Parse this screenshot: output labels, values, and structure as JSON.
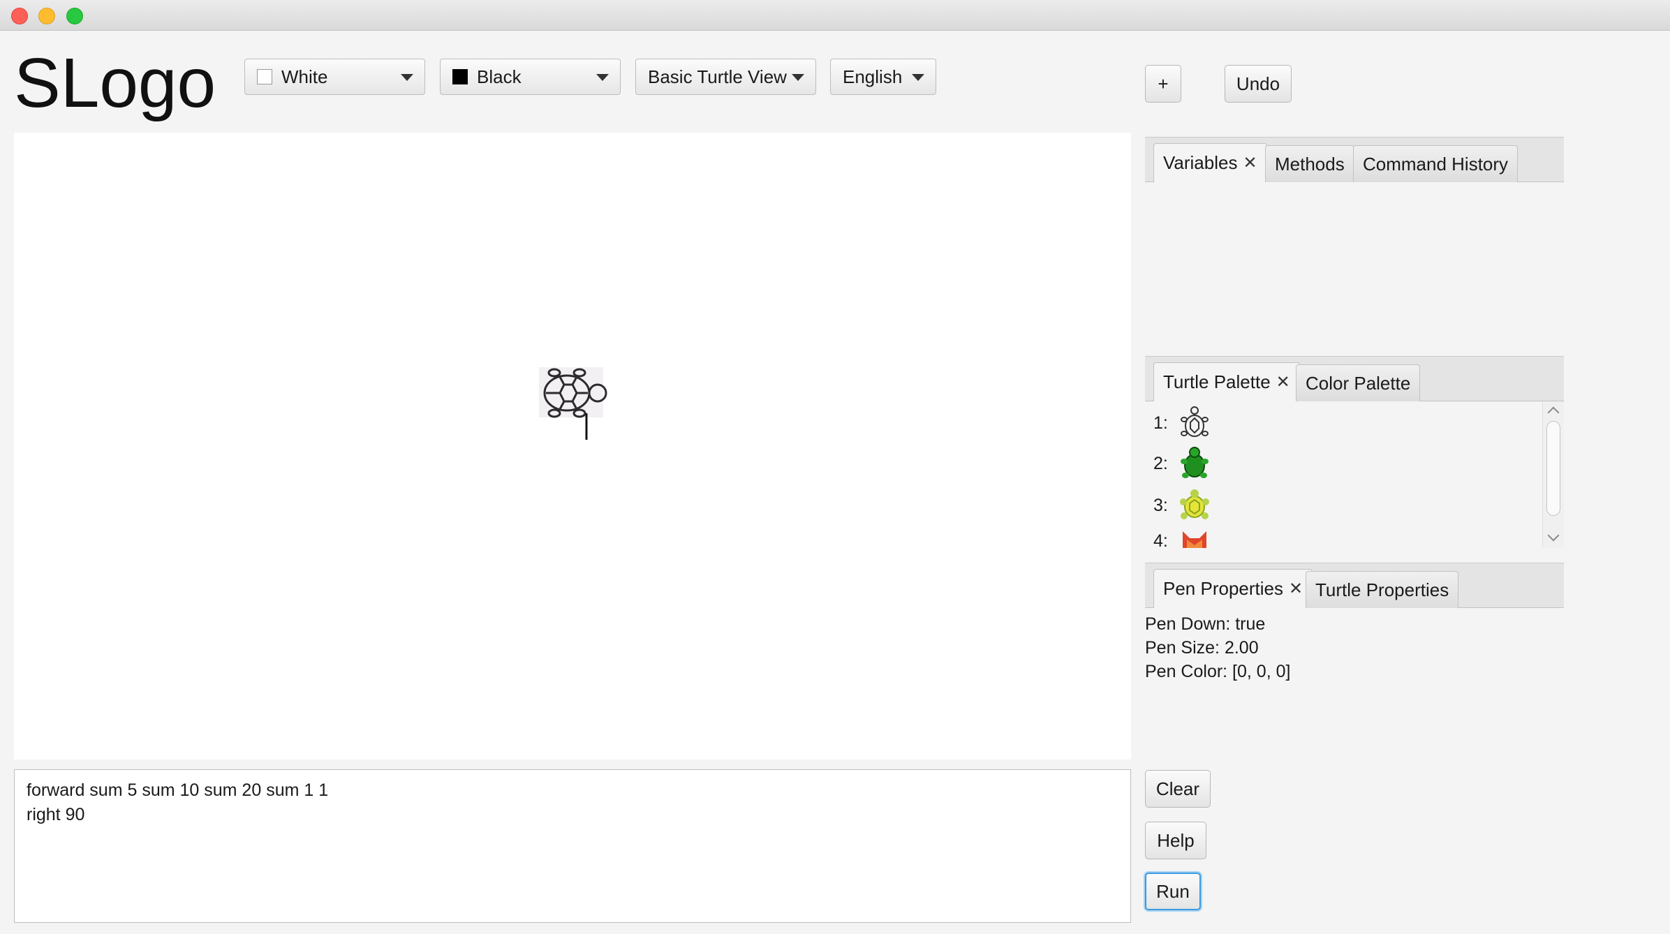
{
  "app": {
    "title": "SLogo"
  },
  "toolbar": {
    "background_combo": {
      "label": "White",
      "swatch_color": "#ffffff"
    },
    "pen_combo": {
      "label": "Black",
      "swatch_color": "#000000"
    },
    "view_combo": {
      "label": "Basic Turtle View"
    },
    "language_combo": {
      "label": "English"
    },
    "add_label": "+",
    "undo_label": "Undo"
  },
  "canvas": {
    "background": "#ffffff",
    "turtle_icon": "turtle-outline-icon"
  },
  "editor": {
    "lines": [
      "forward sum 5 sum 10 sum 20 sum 1 1",
      "right 90"
    ]
  },
  "top_tabs": {
    "tabs": [
      {
        "label": "Variables",
        "active": true,
        "closable": true
      },
      {
        "label": "Methods",
        "active": false,
        "closable": false
      },
      {
        "label": "Command History",
        "active": false,
        "closable": false
      }
    ]
  },
  "palette_tabs": {
    "tabs": [
      {
        "label": "Turtle Palette",
        "active": true,
        "closable": true
      },
      {
        "label": "Color Palette",
        "active": false,
        "closable": false
      }
    ],
    "items": [
      {
        "index": "1:",
        "icon": "turtle-outline-icon"
      },
      {
        "index": "2:",
        "icon": "green-turtle-icon"
      },
      {
        "index": "3:",
        "icon": "yellow-turtle-icon"
      },
      {
        "index": "4:",
        "icon": "orange-fox-icon"
      }
    ]
  },
  "properties_tabs": {
    "tabs": [
      {
        "label": "Pen Properties",
        "active": true,
        "closable": true
      },
      {
        "label": "Turtle Properties",
        "active": false,
        "closable": false
      }
    ],
    "pen": {
      "pen_down": "Pen Down: true",
      "pen_size": "Pen Size: 2.00",
      "pen_color": "Pen Color: [0, 0, 0]"
    }
  },
  "actions": {
    "clear_label": "Clear",
    "help_label": "Help",
    "run_label": "Run"
  },
  "colors": {
    "focus_accent": "#3a9be0",
    "canvas_bg": "#ffffff",
    "window_bg": "#f4f4f4"
  }
}
